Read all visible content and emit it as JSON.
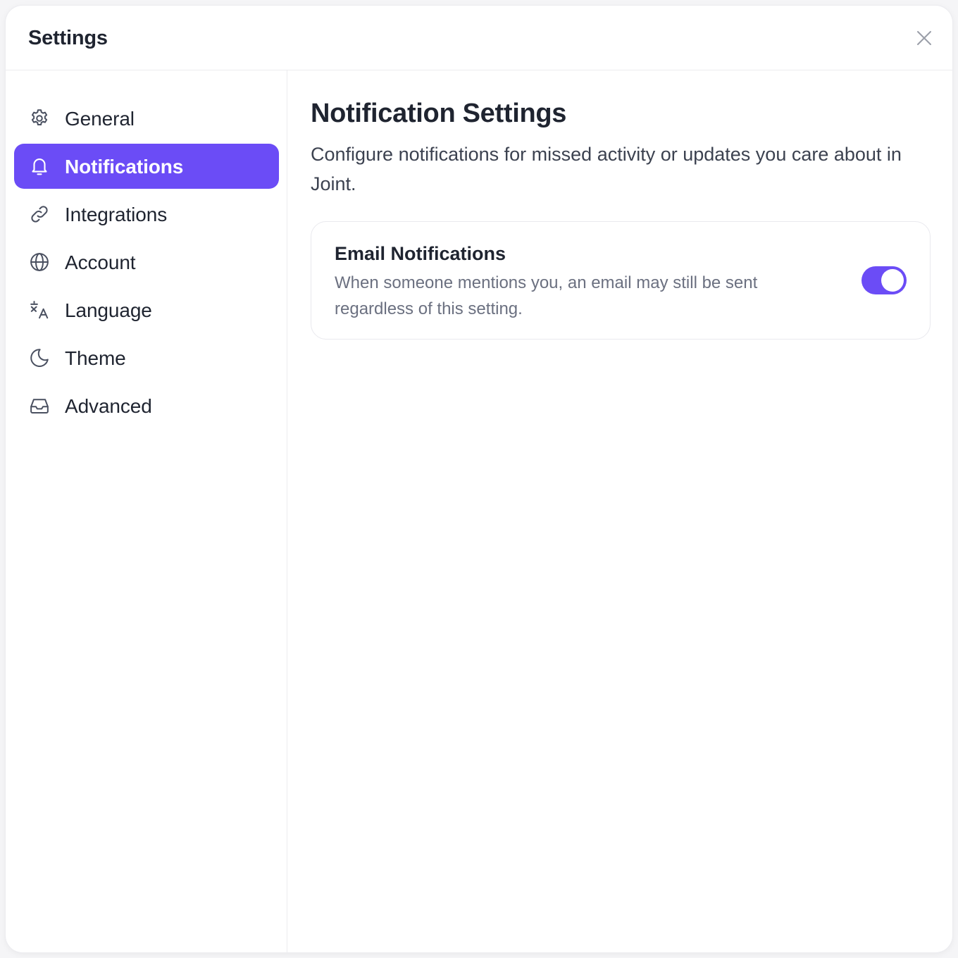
{
  "window": {
    "title": "Settings"
  },
  "sidebar": {
    "items": [
      {
        "label": "General",
        "icon": "gear-icon",
        "active": false
      },
      {
        "label": "Notifications",
        "icon": "bell-icon",
        "active": true
      },
      {
        "label": "Integrations",
        "icon": "link-icon",
        "active": false
      },
      {
        "label": "Account",
        "icon": "globe-icon",
        "active": false
      },
      {
        "label": "Language",
        "icon": "translate-icon",
        "active": false
      },
      {
        "label": "Theme",
        "icon": "moon-icon",
        "active": false
      },
      {
        "label": "Advanced",
        "icon": "inbox-icon",
        "active": false
      }
    ]
  },
  "main": {
    "title": "Notification Settings",
    "description": "Configure notifications for missed activity or updates you care about in Joint.",
    "email_card": {
      "title": "Email Notifications",
      "description": "When someone mentions you, an email may still be sent regardless of this setting.",
      "toggle_on": true
    }
  },
  "colors": {
    "accent": "#6b4cf6",
    "text_primary": "#1f2430",
    "text_secondary": "#6b7080",
    "icon": "#4a5060"
  }
}
